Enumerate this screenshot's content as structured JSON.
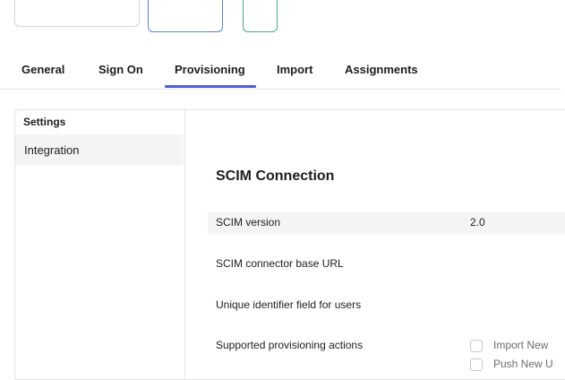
{
  "tabs": [
    {
      "label": "General"
    },
    {
      "label": "Sign On"
    },
    {
      "label": "Provisioning"
    },
    {
      "label": "Import"
    },
    {
      "label": "Assignments"
    }
  ],
  "active_tab": "Provisioning",
  "sidebar": {
    "title": "Settings",
    "items": [
      {
        "label": "Integration"
      }
    ]
  },
  "section": {
    "title": "SCIM Connection"
  },
  "rows": {
    "scim_version": {
      "label": "SCIM version",
      "value": "2.0"
    },
    "base_url": {
      "label": "SCIM connector base URL"
    },
    "unique_id": {
      "label": "Unique identifier field for users"
    },
    "actions": {
      "label": "Supported provisioning actions",
      "options": [
        {
          "label": "Import New",
          "checked": false
        },
        {
          "label": "Push New U",
          "checked": false
        }
      ]
    }
  },
  "colors": {
    "accent": "#4a5fd1",
    "panel_shade": "#f4f4f5"
  }
}
